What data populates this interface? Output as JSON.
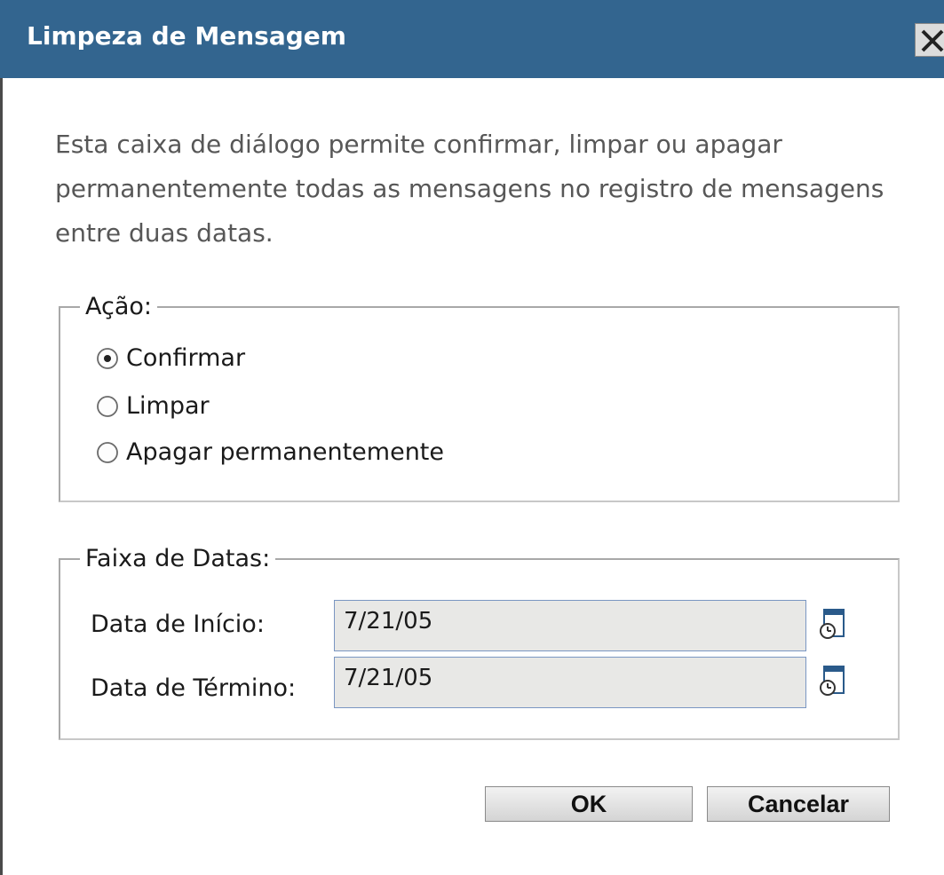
{
  "window": {
    "title": "Limpeza de Mensagem",
    "close_icon": "close-icon"
  },
  "intro_text": "Esta caixa de diálogo permite confirmar, limpar ou apagar permanentemente todas as mensagens no registro de mensagens entre duas datas.",
  "action_group": {
    "legend": "Ação:",
    "options": [
      {
        "label": "Confirmar",
        "selected": true
      },
      {
        "label": "Limpar",
        "selected": false
      },
      {
        "label": "Apagar permanentemente",
        "selected": false
      }
    ]
  },
  "date_range": {
    "legend": "Faixa de Datas:",
    "start_label": "Data de Início:",
    "start_value": "7/21/05",
    "end_label": "Data de Término:",
    "end_value": "7/21/05",
    "calendar_icon": "calendar-icon"
  },
  "buttons": {
    "ok": "OK",
    "cancel": "Cancelar"
  },
  "colors": {
    "titlebar": "#33658f",
    "input_border": "#7a96c2"
  }
}
